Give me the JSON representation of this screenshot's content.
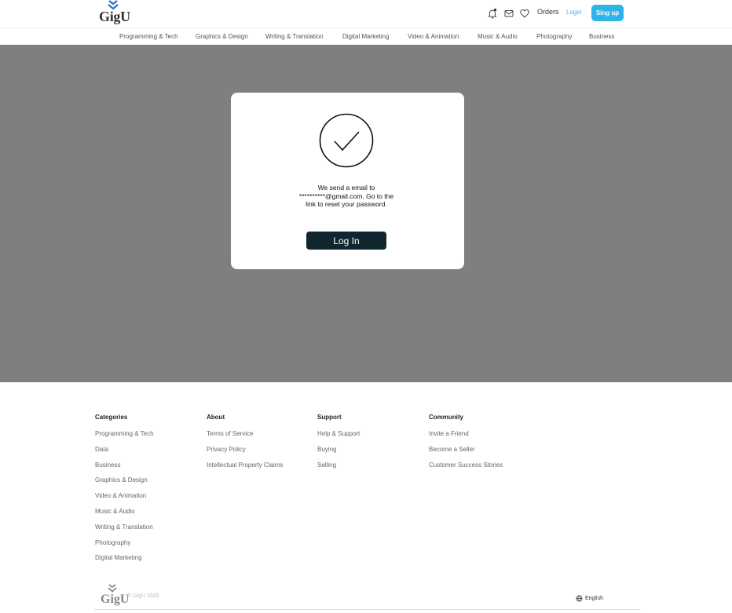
{
  "brand": {
    "name": "GigU"
  },
  "header": {
    "orders_label": "Orders",
    "login_label": "Login",
    "signup_label": "Sing up",
    "icons": [
      "bell-icon",
      "mail-icon",
      "heart-icon"
    ]
  },
  "categories_nav": [
    "Programming & Tech",
    "Graphics & Design",
    "Writing & Translation",
    "Digital Marketing",
    "Video & Animation",
    "Music & Audio",
    "Photography",
    "Business"
  ],
  "modal": {
    "icon": "check-circle-icon",
    "message_lines": [
      "We send a email to",
      "**********@gmail.com. Go to the",
      "link to reset your password."
    ],
    "button_label": "Log In"
  },
  "footer": {
    "columns": [
      {
        "title": "Categories",
        "links": [
          "Programming & Tech",
          "Data",
          "Business",
          "Graphics & Design",
          "Video & Animation",
          "Music & Audio",
          "Writing & Translation",
          "Photography",
          "Digital Marketing"
        ]
      },
      {
        "title": "About",
        "links": [
          "Terms of Service",
          "Privacy Policy",
          "Intellectual Property Claims"
        ]
      },
      {
        "title": "Support",
        "links": [
          "Help & Support",
          "Buying",
          "Selling"
        ]
      },
      {
        "title": "Community",
        "links": [
          "Invite a Friend",
          "Become a Seller",
          "Customer Success Stories"
        ]
      }
    ],
    "copyright": "© GigU 2025",
    "language": "English"
  },
  "colors": {
    "accent": "#2db4e8",
    "button_dark": "#10262e",
    "overlay": "#7f7f7f",
    "logo_mark": "#2a6fc9"
  }
}
